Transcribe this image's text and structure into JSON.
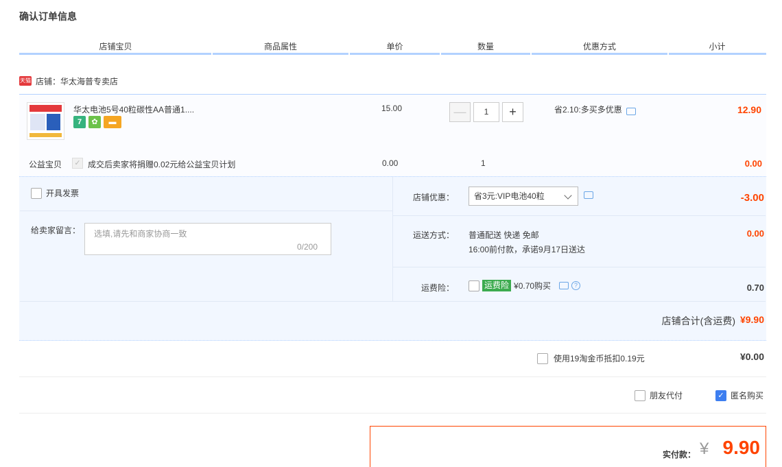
{
  "title": "确认订单信息",
  "columns": [
    "店铺宝贝",
    "商品属性",
    "单价",
    "数量",
    "优惠方式",
    "小计"
  ],
  "shop": {
    "badge": "天猫",
    "name": "店铺：华太海普专卖店"
  },
  "item": {
    "title": "华太电池5号40粒碳性AA普通1....",
    "service_icons": [
      "seven-day-return-icon",
      "guarantee-icon",
      "credit-card-icon"
    ],
    "price": "15.00",
    "qty": "1",
    "qty_minus": "—",
    "qty_plus": "+",
    "discount": "省2.10:多买多优惠",
    "subtotal": "12.90"
  },
  "charity": {
    "label": "公益宝贝",
    "check": "✓",
    "text": "成交后卖家将捐赠0.02元给公益宝贝计划",
    "price": "0.00",
    "qty": "1",
    "subtotal": "0.00"
  },
  "invoice": {
    "label": "开具发票",
    "checked": false
  },
  "message": {
    "label": "给卖家留言：",
    "placeholder": "选填,请先和商家协商一致",
    "count": "0/200"
  },
  "shop_discount": {
    "label": "店铺优惠：",
    "selected": "省3元:VIP电池40粒",
    "value": "-3.00"
  },
  "shipping": {
    "label": "运送方式：",
    "line1": "普通配送 快递 免邮",
    "line2": "16:00前付款，承诺9月17日送达",
    "fee": "0.00"
  },
  "insurance": {
    "label": "运费险：",
    "tag": "运费险",
    "price": "¥0.70购买",
    "help": "?",
    "fee": "0.70",
    "checked": false
  },
  "shop_total": {
    "label": "店铺合计(含运费)",
    "value": "¥9.90"
  },
  "coin": {
    "label": "使用19淘金币抵扣0.19元",
    "value": "¥0.00",
    "checked": false
  },
  "friend_pay": {
    "label": "朋友代付",
    "checked": false
  },
  "anonymous": {
    "label": "匿名购买",
    "checked": true,
    "check": "✓"
  },
  "pay": {
    "label": "实付款：",
    "yen": "¥",
    "value": "9.90"
  }
}
